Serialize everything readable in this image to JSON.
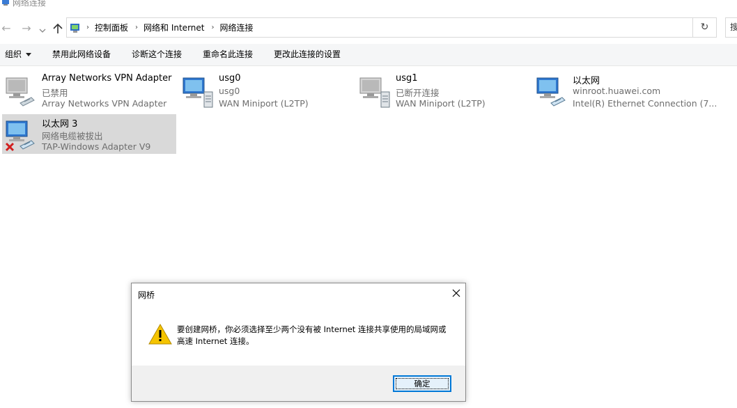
{
  "window": {
    "title": "网络连接"
  },
  "breadcrumbs": [
    "控制面板",
    "网络和 Internet",
    "网络连接"
  ],
  "search": {
    "placeholder": "搜"
  },
  "toolbar": {
    "organize": "组织",
    "disable": "禁用此网络设备",
    "diagnose": "诊断这个连接",
    "rename": "重命名此连接",
    "settings": "更改此连接的设置"
  },
  "connections": [
    {
      "name": "Array Networks VPN Adapter",
      "status": "已禁用",
      "device": "Array Networks VPN Adapter",
      "icon": "ethernet-adapter-icon"
    },
    {
      "name": "usg0",
      "status": "usg0",
      "device": "WAN Miniport (L2TP)",
      "icon": "vpn-connection-icon"
    },
    {
      "name": "usg1",
      "status": "已断开连接",
      "device": "WAN Miniport (L2TP)",
      "icon": "vpn-connection-icon"
    },
    {
      "name": "以太网",
      "status": "winroot.huawei.com",
      "device": "Intel(R) Ethernet Connection (7...",
      "icon": "ethernet-adapter-icon"
    },
    {
      "name": "以太网 3",
      "status": "网络电缆被拔出",
      "device": "TAP-Windows Adapter V9",
      "icon": "ethernet-adapter-icon",
      "selected": true,
      "error": "red-x-icon"
    }
  ],
  "dialog": {
    "title": "网桥",
    "message": "要创建网桥，你必须选择至少两个没有被 Internet 连接共享使用的局域网或高速 Internet 连接。",
    "ok": "确定"
  },
  "colors": {
    "accent": "#0078d7",
    "selection": "#d9d9d9",
    "warning": "#f5c400"
  }
}
